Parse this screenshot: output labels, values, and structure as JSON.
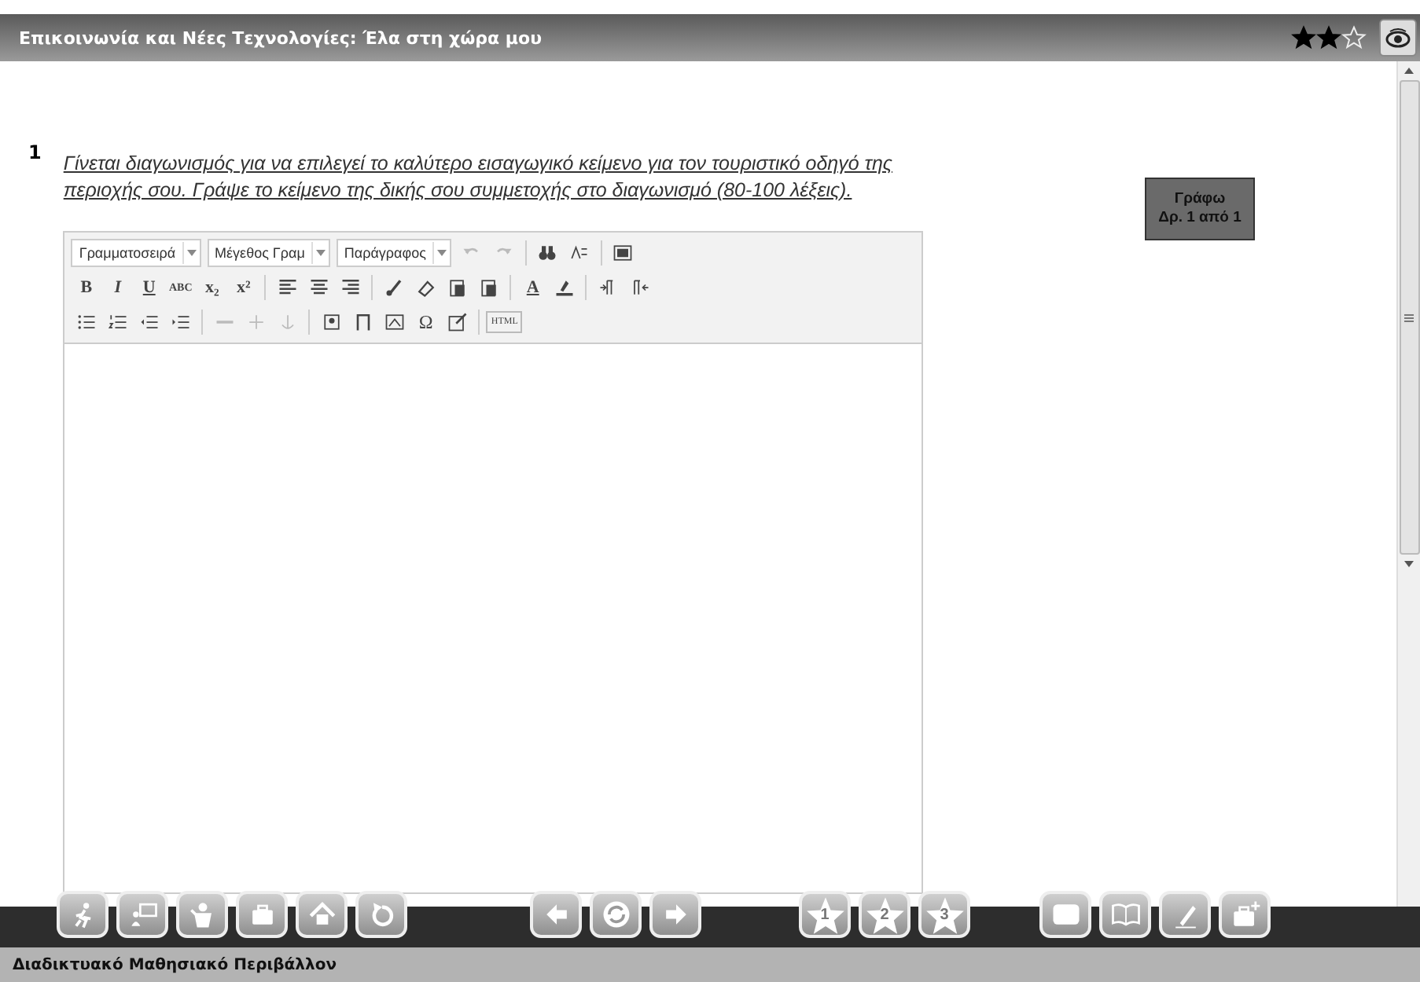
{
  "window": {
    "title": "Επικοινωνία και Νέες Τεχνολογίες: Έλα στη χώρα μου",
    "rating": {
      "stars": 2
    }
  },
  "question": {
    "number": "1",
    "text": "Γίνεται διαγωνισμός για να επιλεγεί το καλύτερο εισαγωγικό κείμενο για τον τουριστικό οδηγό της περιοχής σου. Γράψε το κείμενο της δικής σου συμμετοχής στο διαγωνισμό (80-100 λέξεις)."
  },
  "write_button": {
    "lines": [
      "Γράφω",
      "Δρ. 1 από 1"
    ]
  },
  "editor": {
    "toolbar_rows": [
      [
        {
          "kind": "dropdown",
          "label": "Γραμματοσειρά"
        },
        {
          "kind": "dropdown",
          "label": "Μέγεθος Γραμ"
        },
        {
          "kind": "dropdown",
          "label": "Παράγραφος"
        },
        {
          "kind": "icon",
          "disabled": true
        },
        {
          "kind": "icon",
          "disabled": true
        },
        {
          "kind": "sep"
        },
        {
          "kind": "icon",
          "disabled": false
        },
        {
          "kind": "icon",
          "disabled": false
        },
        {
          "kind": "sep"
        },
        {
          "kind": "icon",
          "disabled": false
        }
      ],
      [
        {
          "kind": "glyph",
          "label": "B"
        },
        {
          "kind": "glyph",
          "label": "I"
        },
        {
          "kind": "glyph",
          "label": "U"
        },
        {
          "kind": "glyph",
          "label": "ABC"
        },
        {
          "kind": "glyph",
          "label": "x₂"
        },
        {
          "kind": "glyph",
          "label": "x²"
        },
        {
          "kind": "sep"
        },
        {
          "kind": "icon",
          "disabled": false
        },
        {
          "kind": "icon",
          "disabled": false
        },
        {
          "kind": "icon",
          "disabled": false
        },
        {
          "kind": "sep"
        },
        {
          "kind": "icon",
          "disabled": false
        },
        {
          "kind": "icon",
          "disabled": false
        },
        {
          "kind": "icon",
          "disabled": false
        },
        {
          "kind": "icon",
          "disabled": false
        },
        {
          "kind": "sep"
        },
        {
          "kind": "glyph",
          "label": "A"
        },
        {
          "kind": "icon",
          "disabled": false
        },
        {
          "kind": "sep"
        },
        {
          "kind": "icon",
          "disabled": false
        },
        {
          "kind": "icon",
          "disabled": false
        }
      ],
      [
        {
          "kind": "icon",
          "disabled": false
        },
        {
          "kind": "icon",
          "disabled": false
        },
        {
          "kind": "icon",
          "disabled": false
        },
        {
          "kind": "icon",
          "disabled": false
        },
        {
          "kind": "sep"
        },
        {
          "kind": "icon",
          "disabled": true
        },
        {
          "kind": "icon",
          "disabled": true
        },
        {
          "kind": "icon",
          "disabled": true
        },
        {
          "kind": "sep"
        },
        {
          "kind": "icon",
          "disabled": false
        },
        {
          "kind": "icon",
          "disabled": false
        },
        {
          "kind": "icon",
          "disabled": false
        },
        {
          "kind": "glyph",
          "label": "Ω"
        },
        {
          "kind": "icon",
          "disabled": false
        },
        {
          "kind": "sep"
        },
        {
          "kind": "glyph",
          "label": "HTML"
        }
      ]
    ]
  },
  "bottom_toolbar": [
    [
      {
        "kind": "icon"
      },
      {
        "kind": "icon"
      },
      {
        "kind": "icon"
      },
      {
        "kind": "icon"
      },
      {
        "kind": "icon"
      },
      {
        "kind": "icon"
      }
    ],
    [
      {
        "kind": "icon"
      },
      {
        "kind": "icon"
      },
      {
        "kind": "icon"
      }
    ],
    [
      {
        "kind": "star",
        "label": "1"
      },
      {
        "kind": "star",
        "label": "2"
      },
      {
        "kind": "star",
        "label": "3"
      }
    ],
    [
      {
        "kind": "icon"
      },
      {
        "kind": "icon"
      },
      {
        "kind": "icon"
      },
      {
        "kind": "icon"
      }
    ]
  ],
  "status_bar": "Διαδικτυακό Μαθησιακό Περιβάλλον"
}
